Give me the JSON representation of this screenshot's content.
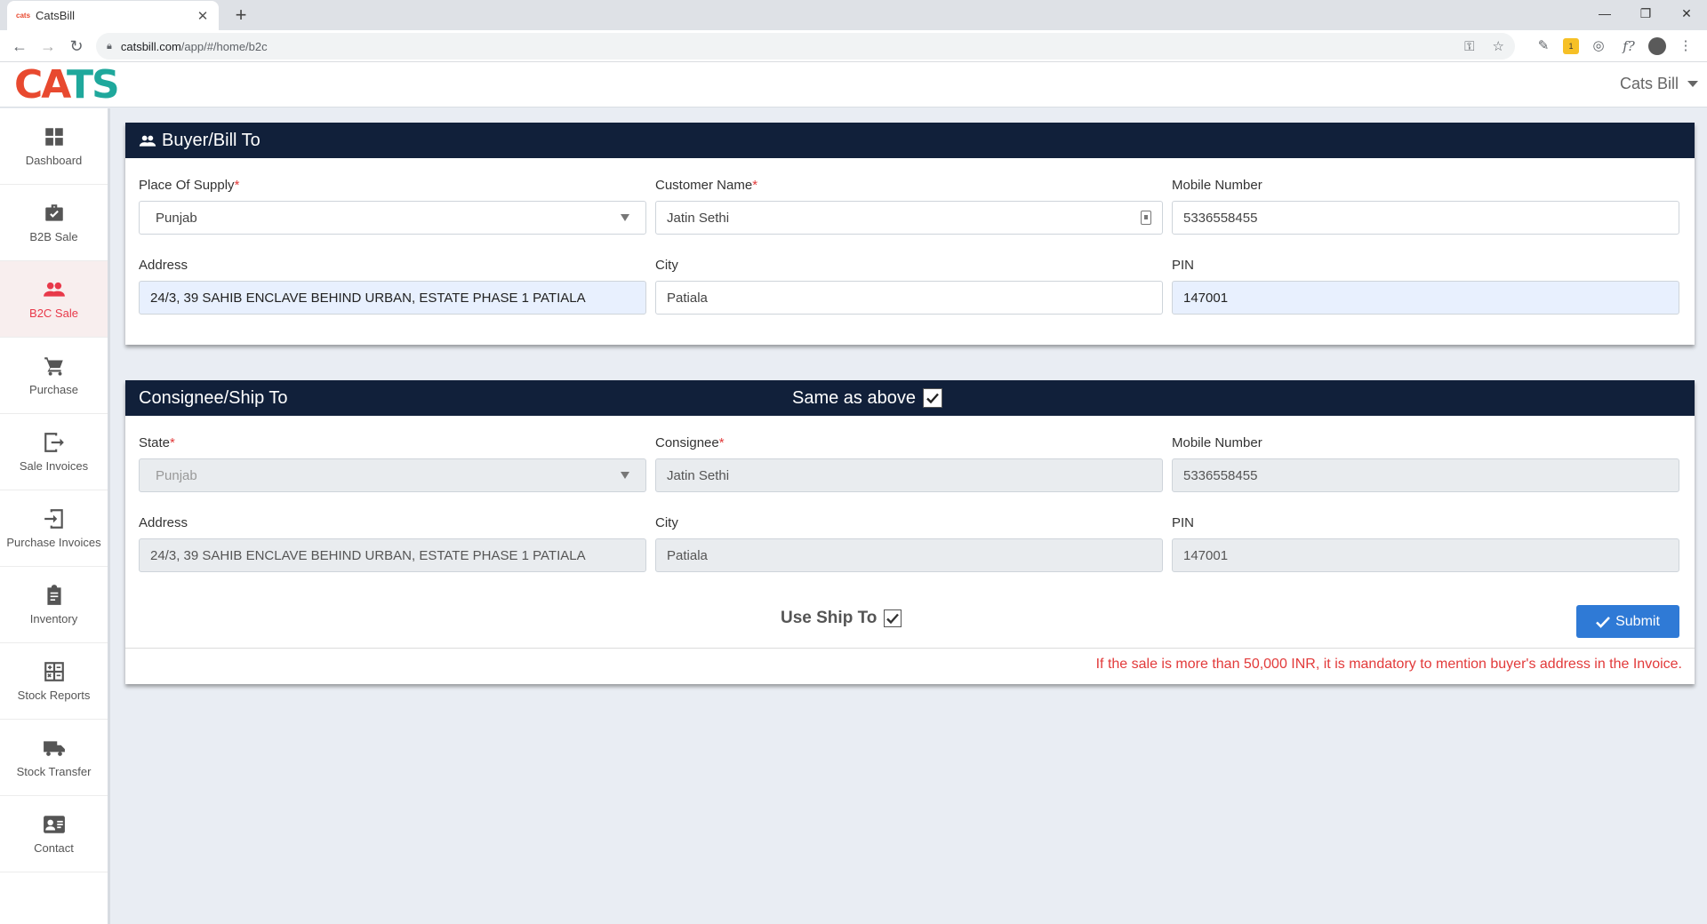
{
  "browser": {
    "tab_favicon_text": "cats",
    "tab_title": "CatsBill",
    "tab_close": "✕",
    "new_tab": "+",
    "url_host": "catsbill.com",
    "url_path": "/app/#/home/b2c",
    "win_min": "—",
    "win_max": "❐",
    "win_close": "✕",
    "ext_badge": "1"
  },
  "header": {
    "logo_part1": "CA",
    "logo_part2": "TS",
    "user_name": "Cats Bill"
  },
  "sidebar": {
    "items": [
      {
        "label": "Dashboard",
        "icon": "dashboard-icon"
      },
      {
        "label": "B2B Sale",
        "icon": "briefcase-check-icon"
      },
      {
        "label": "B2C Sale",
        "icon": "people-icon"
      },
      {
        "label": "Purchase",
        "icon": "cart-icon"
      },
      {
        "label": "Sale Invoices",
        "icon": "exit-icon"
      },
      {
        "label": "Purchase Invoices",
        "icon": "enter-icon"
      },
      {
        "label": "Inventory",
        "icon": "clipboard-icon"
      },
      {
        "label": "Stock Reports",
        "icon": "calculator-icon"
      },
      {
        "label": "Stock Transfer",
        "icon": "truck-icon"
      },
      {
        "label": "Contact",
        "icon": "contact-card-icon"
      }
    ],
    "active_index": 2
  },
  "buyer": {
    "title": "Buyer/Bill To",
    "place_of_supply": {
      "label": "Place Of Supply",
      "value": "Punjab"
    },
    "customer_name": {
      "label": "Customer Name",
      "value": "Jatin Sethi"
    },
    "mobile": {
      "label": "Mobile Number",
      "value": "5336558455"
    },
    "address": {
      "label": "Address",
      "value": "24/3, 39 SAHIB ENCLAVE  BEHIND URBAN, ESTATE PHASE 1 PATIALA"
    },
    "city": {
      "label": "City",
      "value": "Patiala"
    },
    "pin": {
      "label": "PIN",
      "value": "147001"
    }
  },
  "consignee": {
    "title": "Consignee/Ship To",
    "same_as_above_label": "Same as above",
    "same_as_above_checked": true,
    "state": {
      "label": "State",
      "value": "Punjab"
    },
    "consignee_name": {
      "label": "Consignee",
      "value": "Jatin Sethi"
    },
    "mobile": {
      "label": "Mobile Number",
      "value": "5336558455"
    },
    "address": {
      "label": "Address",
      "value": "24/3, 39 SAHIB ENCLAVE  BEHIND URBAN, ESTATE PHASE 1 PATIALA"
    },
    "city": {
      "label": "City",
      "value": "Patiala"
    },
    "pin": {
      "label": "PIN",
      "value": "147001"
    },
    "use_ship_to_label": "Use Ship To",
    "use_ship_to_checked": true,
    "submit_label": "Submit",
    "warning": "If the sale is more than 50,000 INR, it is mandatory to mention buyer's address in the Invoice."
  },
  "colors": {
    "header_bg": "#11203a",
    "accent_red": "#e8394a",
    "submit_blue": "#2f7ad6",
    "logo_red": "#e8492f",
    "logo_teal": "#1fa89c"
  }
}
